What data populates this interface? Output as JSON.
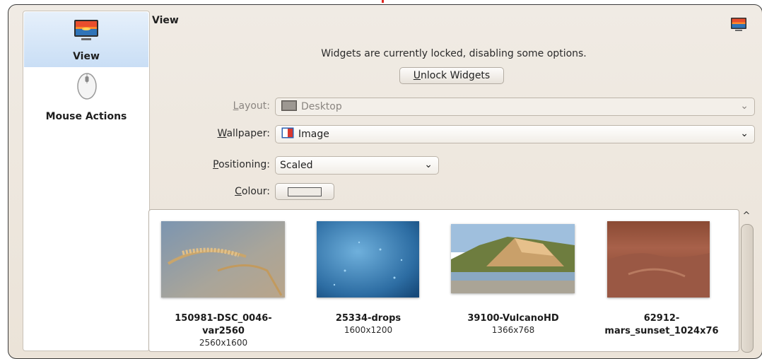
{
  "sidebar": {
    "items": [
      {
        "label": "View",
        "icon": "monitor-icon",
        "selected": true
      },
      {
        "label": "Mouse Actions",
        "icon": "mouse-icon",
        "selected": false
      }
    ]
  },
  "header": {
    "title": "View",
    "icon": "monitor-icon"
  },
  "notice": "Widgets are currently locked, disabling some options.",
  "unlock_button": {
    "label": "Unlock Widgets",
    "mnemonic": "U",
    "rest": "nlock Widgets"
  },
  "form": {
    "layout": {
      "label_mn": "L",
      "label_rest": "ayout:",
      "value": "Desktop",
      "disabled": true
    },
    "wallpaper": {
      "label_mn": "W",
      "label_rest": "allpaper:",
      "value": "Image"
    },
    "positioning": {
      "label_mn": "P",
      "label_rest": "ositioning:",
      "value": "Scaled"
    },
    "colour": {
      "label_mn": "C",
      "label_rest": "olour:"
    }
  },
  "wallpapers": [
    {
      "name_line1": "150981-DSC_0046-",
      "name_line2": "var2560",
      "resolution": "2560x1600"
    },
    {
      "name_line1": "25334-drops",
      "name_line2": "",
      "resolution": "1600x1200"
    },
    {
      "name_line1": "39100-VulcanoHD",
      "name_line2": "",
      "resolution": "1366x768"
    },
    {
      "name_line1": "62912-",
      "name_line2": "mars_sunset_1024x76",
      "resolution": ""
    }
  ],
  "colors": {
    "selection": "#c9def5",
    "window_bg": "#ebe3d8"
  }
}
